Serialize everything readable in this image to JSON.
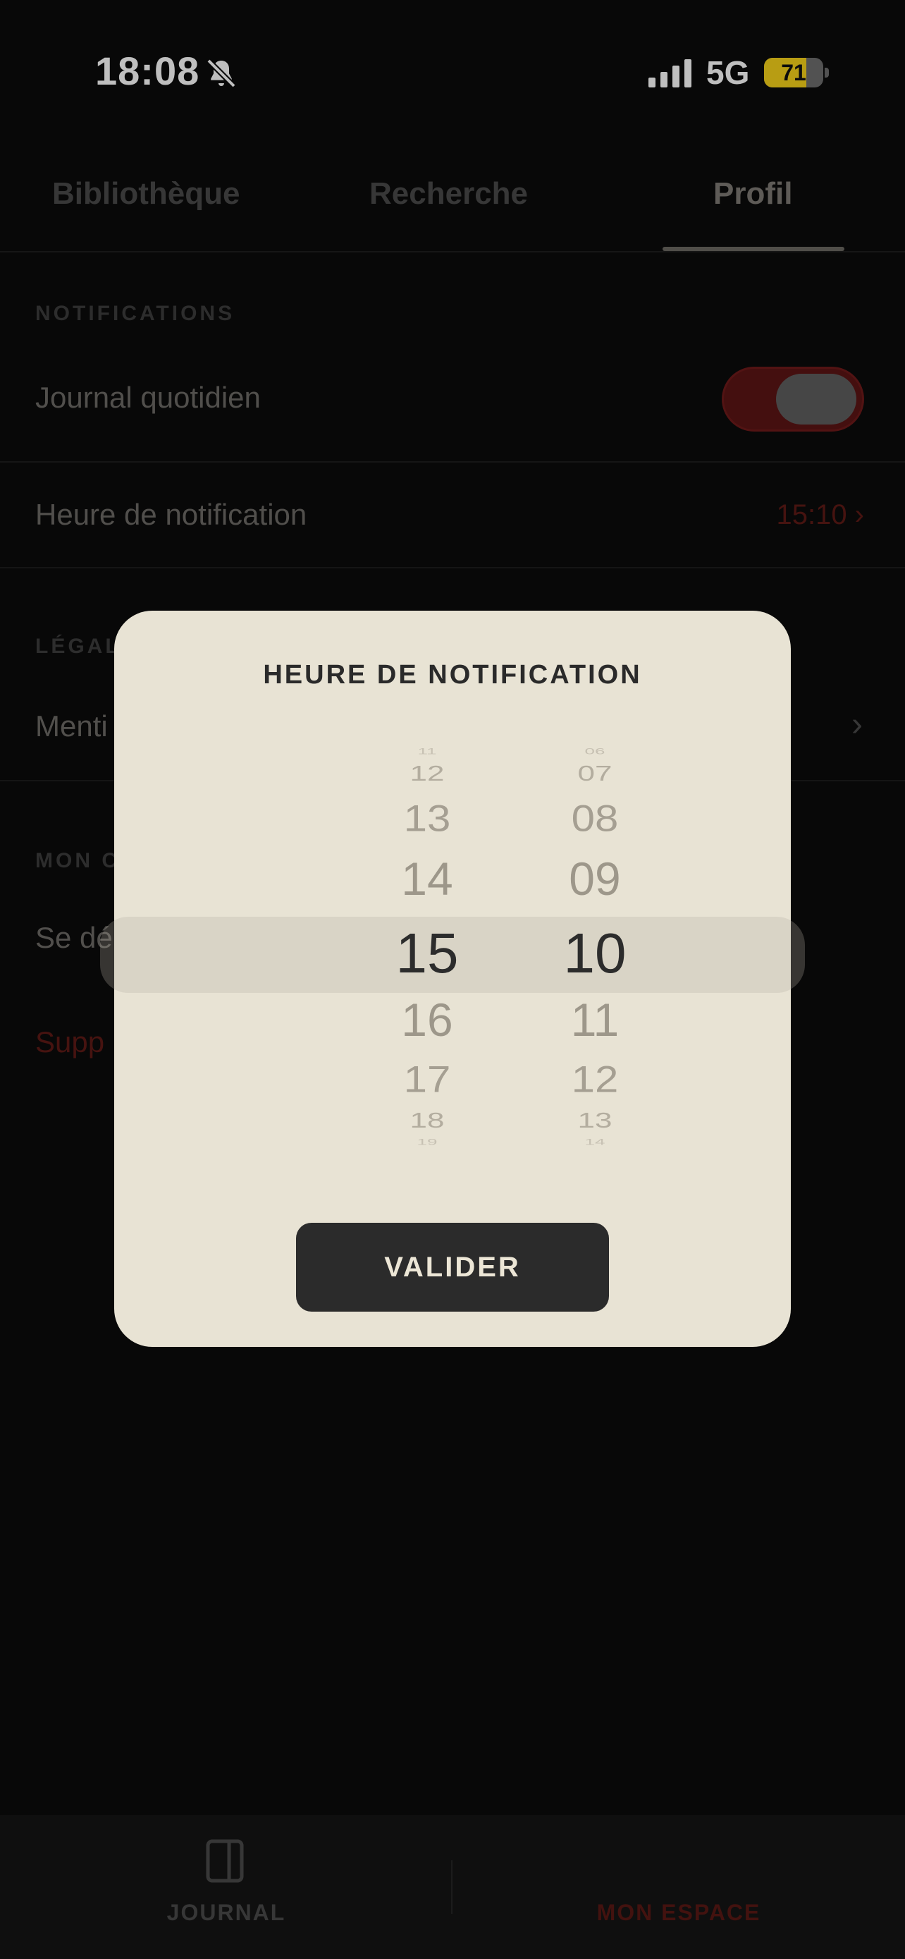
{
  "status_bar": {
    "time": "18:08",
    "network": "5G",
    "battery": "71",
    "battery_level": 0.71,
    "colors": {
      "battery": "#f6d21a"
    }
  },
  "tabs": [
    {
      "label": "Bibliothèque",
      "active": false
    },
    {
      "label": "Recherche",
      "active": false
    },
    {
      "label": "Profil",
      "active": true
    }
  ],
  "settings": {
    "notifications_section": "NOTIFICATIONS",
    "daily_journal_label": "Journal quotidien",
    "daily_journal_enabled": true,
    "notification_time_label": "Heure de notification",
    "notification_time_value": "15:10 ›",
    "legal_section_visible": "LÉGAL",
    "mentions_visible": "Menti",
    "account_section_visible": "MON C",
    "logout_visible": "Se dé",
    "delete_visible": "Supp"
  },
  "modal": {
    "title": "HEURE DE NOTIFICATION",
    "hours": [
      "11",
      "12",
      "13",
      "14",
      "15",
      "16",
      "17",
      "18",
      "19"
    ],
    "minutes": [
      "06",
      "07",
      "08",
      "09",
      "10",
      "11",
      "12",
      "13",
      "14"
    ],
    "selected_hour": "15",
    "selected_minute": "10",
    "confirm_label": "VALIDER"
  },
  "bottom_nav": {
    "journal_label": "JOURNAL",
    "espace_label": "MON ESPACE",
    "colors": {
      "active": "#5a1814"
    }
  },
  "icons": {
    "bell": "bell-slash-icon",
    "signal": "signal-icon",
    "journal": "journal-icon",
    "user": "user-circle-icon"
  }
}
